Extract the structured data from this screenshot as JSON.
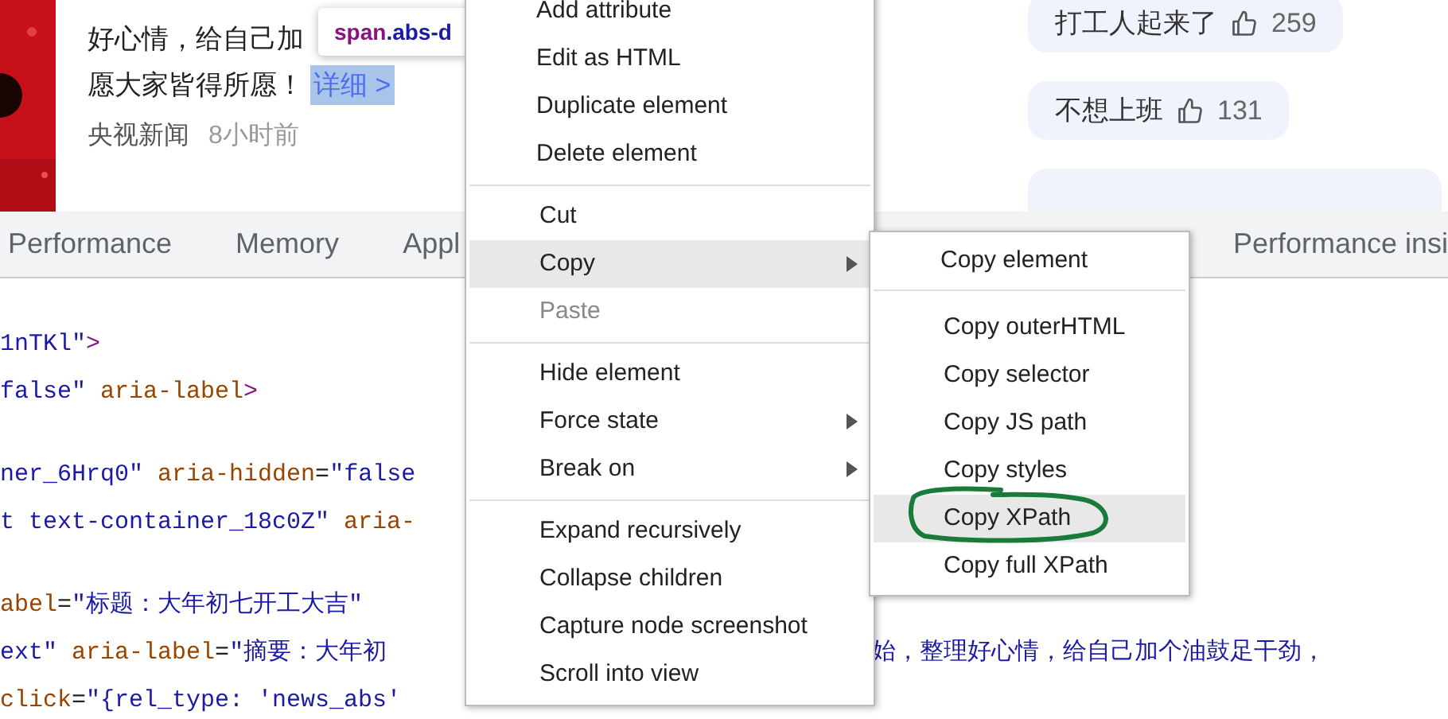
{
  "article": {
    "lines": [
      "好心情，给自己加",
      "愿大家皆得所愿！"
    ],
    "link": "详细 >",
    "source": "央视新闻",
    "time": "8小时前"
  },
  "tooltip": {
    "tag": "span",
    "cls": ".abs-d"
  },
  "comments": [
    {
      "text": "打工人起来了",
      "likes": "259"
    },
    {
      "text": "不想上班",
      "likes": "131"
    }
  ],
  "tabs": [
    {
      "label": "Performance",
      "selected": false
    },
    {
      "label": "Memory",
      "selected": false
    },
    {
      "label": "Appl",
      "selected": false
    }
  ],
  "right_tab": {
    "label": "Performance insi",
    "selected": false
  },
  "code_lines": [
    {
      "blank_before": false,
      "left": [
        {
          "kind": "value",
          "text": "1nTKl\""
        },
        {
          "kind": "tag",
          "text": ">"
        }
      ]
    },
    {
      "blank_before": false,
      "left": [
        {
          "kind": "value",
          "text": "false\""
        },
        {
          "kind": "attr",
          "text": " aria-label"
        },
        {
          "kind": "tag",
          "text": ">"
        }
      ]
    },
    {
      "blank_before": true,
      "left": [
        {
          "kind": "value",
          "text": "ner_6Hrq0\""
        },
        {
          "kind": "attr",
          "text": " aria-hidden"
        },
        {
          "kind": "plain",
          "text": "="
        },
        {
          "kind": "value",
          "text": "\"false"
        }
      ]
    },
    {
      "blank_before": false,
      "left": [
        {
          "kind": "value",
          "text": "t text-container_18c0Z\""
        },
        {
          "kind": "attr",
          "text": " aria-"
        }
      ]
    },
    {
      "blank_before": true,
      "left": [
        {
          "kind": "attr",
          "text": "abel"
        },
        {
          "kind": "plain",
          "text": "="
        },
        {
          "kind": "value",
          "text": "\"标题：大年初七开工大吉\""
        }
      ]
    },
    {
      "blank_before": false,
      "left": [
        {
          "kind": "value",
          "text": "ext\""
        },
        {
          "kind": "attr",
          "text": " aria-label"
        },
        {
          "kind": "plain",
          "text": "="
        },
        {
          "kind": "value",
          "text": "\"摘要：大年初"
        }
      ],
      "right": [
        {
          "kind": "value",
          "text": "始，整理好心情，给自己加个油鼓足干劲，"
        }
      ]
    },
    {
      "blank_before": false,
      "left": [
        {
          "kind": "attr",
          "text": "click"
        },
        {
          "kind": "plain",
          "text": "="
        },
        {
          "kind": "value",
          "text": "\"{rel_type: 'news_abs'"
        }
      ]
    }
  ],
  "menu": {
    "groups": [
      [
        {
          "label": "Add attribute",
          "disabled": false,
          "selected": false,
          "submenu": false
        },
        {
          "label": "Edit as HTML",
          "disabled": false,
          "selected": false,
          "submenu": false
        },
        {
          "label": "Duplicate element",
          "disabled": false,
          "selected": false,
          "submenu": false
        },
        {
          "label": "Delete element",
          "disabled": false,
          "selected": false,
          "submenu": false
        }
      ],
      [
        {
          "label": "Cut",
          "disabled": false,
          "selected": false,
          "submenu": false
        },
        {
          "label": "Copy",
          "disabled": false,
          "selected": true,
          "submenu": true
        },
        {
          "label": "Paste",
          "disabled": true,
          "selected": false,
          "submenu": false
        }
      ],
      [
        {
          "label": "Hide element",
          "disabled": false,
          "selected": false,
          "submenu": false
        },
        {
          "label": "Force state",
          "disabled": false,
          "selected": false,
          "submenu": true
        },
        {
          "label": "Break on",
          "disabled": false,
          "selected": false,
          "submenu": true
        }
      ],
      [
        {
          "label": "Expand recursively",
          "disabled": false,
          "selected": false,
          "submenu": false
        },
        {
          "label": "Collapse children",
          "disabled": false,
          "selected": false,
          "submenu": false
        },
        {
          "label": "Capture node screenshot",
          "disabled": false,
          "selected": false,
          "submenu": false
        },
        {
          "label": "Scroll into view",
          "disabled": false,
          "selected": false,
          "submenu": false
        }
      ]
    ]
  },
  "submenu": {
    "groups": [
      [
        {
          "label": "Copy element",
          "selected": false,
          "annotated": false
        }
      ],
      [
        {
          "label": "Copy outerHTML",
          "selected": false,
          "annotated": false
        },
        {
          "label": "Copy selector",
          "selected": false,
          "annotated": false
        },
        {
          "label": "Copy JS path",
          "selected": false,
          "annotated": false
        },
        {
          "label": "Copy styles",
          "selected": false,
          "annotated": false
        },
        {
          "label": "Copy XPath",
          "selected": true,
          "annotated": true
        },
        {
          "label": "Copy full XPath",
          "selected": false,
          "annotated": false
        }
      ]
    ]
  }
}
